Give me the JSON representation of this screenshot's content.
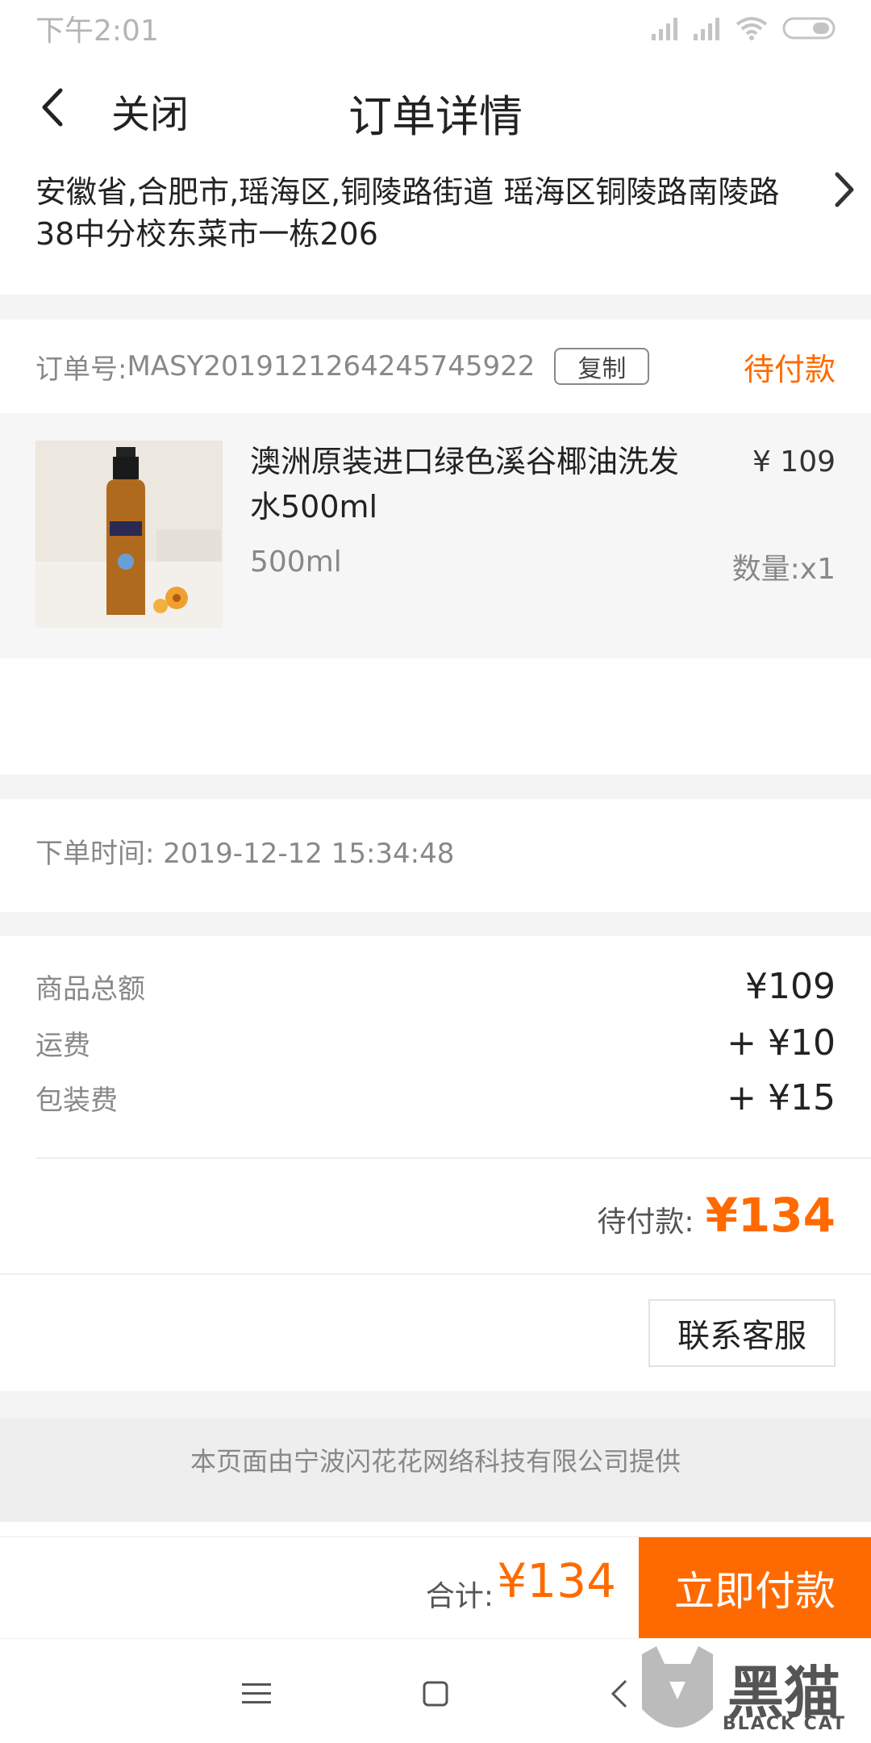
{
  "status_bar": {
    "time": "下午2:01"
  },
  "nav": {
    "close_label": "关闭",
    "title": "订单详情"
  },
  "address": {
    "text": "安徽省,合肥市,瑶海区,铜陵路街道 瑶海区铜陵路南陵路38中分校东菜市一栋206"
  },
  "order": {
    "number_label": "订单号:",
    "number": "MASY2019121264245745922",
    "copy_label": "复制",
    "status": "待付款"
  },
  "product": {
    "name": "澳洲原装进口绿色溪谷椰油洗发水500ml",
    "price": "¥ 109",
    "spec": "500ml",
    "quantity": "数量:x1"
  },
  "order_time": {
    "label": "下单时间:",
    "value": "2019-12-12 15:34:48"
  },
  "fees": [
    {
      "label": "商品总额",
      "value": "¥109"
    },
    {
      "label": "运费",
      "value": "+ ¥10"
    },
    {
      "label": "包装费",
      "value": "+ ¥15"
    }
  ],
  "due": {
    "label": "待付款:",
    "amount": "¥134"
  },
  "service_button": "联系客服",
  "provider_text": "本页面由宁波闪花花网络科技有限公司提供",
  "bottom_bar": {
    "total_label": "合计:",
    "total_amount": "¥134",
    "pay_button": "立即付款"
  },
  "watermark": {
    "cn": "黑猫",
    "en": "BLACK CAT"
  },
  "colors": {
    "accent": "#ff6a00",
    "separator": "#f4f4f4",
    "muted_text": "#888888"
  }
}
